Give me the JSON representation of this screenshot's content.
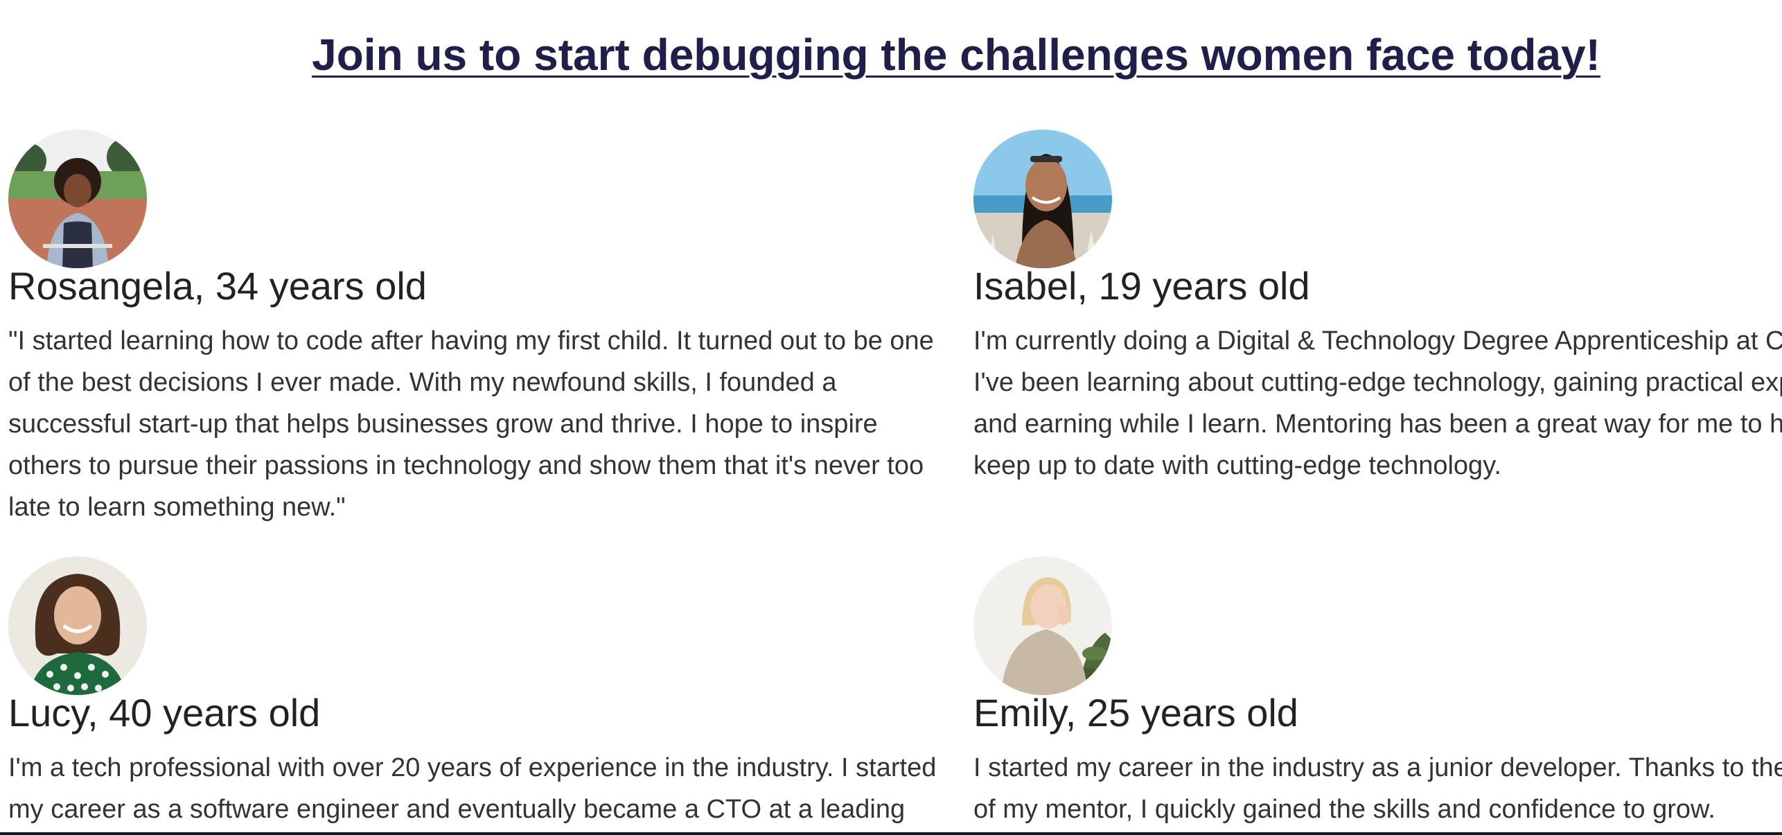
{
  "heading": "Join us to start debugging the challenges women face today!",
  "stories": [
    {
      "name": "Rosangela, 34 years old",
      "quote": "\"I started learning how to code after having my first child. It turned out to be one of the best decisions I ever made. With my newfound skills, I founded a successful start-up that helps businesses grow and thrive. I hope to inspire others to pursue their passions in technology and show them that it's never too late to learn something new.\"",
      "photo_description": "woman with curly hair in denim jacket on a sports court"
    },
    {
      "name": "Isabel, 19 years old",
      "quote": "I'm currently doing a Digital & Technology Degree Apprenticeship at Capgemini. I've been learning about cutting-edge technology, gaining practical experience and earning while I learn. Mentoring has been a great way for me to help others keep up to date with cutting-edge technology.",
      "photo_description": "smiling woman with sunglasses on head by the sea"
    },
    {
      "name": "Lucy, 40 years old",
      "quote": "I'm a tech professional with over 20 years of experience in the industry. I started my career as a software engineer and eventually became a CTO at a leading company.",
      "photo_description": "smiling woman with curly hair in patterned top"
    },
    {
      "name": "Emily, 25 years old",
      "quote": "I started my career in the industry as a junior developer. Thanks to the guidance of my mentor, I quickly gained the skills and confidence to grow.",
      "photo_description": "blonde woman in beige sweater next to a plant"
    }
  ]
}
